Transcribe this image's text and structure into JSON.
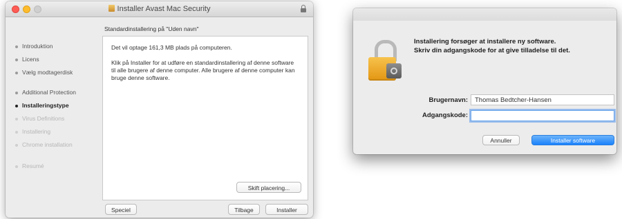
{
  "installer": {
    "title": "Installer Avast Mac Security",
    "pane_heading": "Standardinstallering på \"Uden navn\"",
    "steps": [
      {
        "label": "Introduktion",
        "state": "done"
      },
      {
        "label": "Licens",
        "state": "done"
      },
      {
        "label": "Vælg modtagerdisk",
        "state": "done"
      },
      {
        "label": "Additional Protection",
        "state": "done"
      },
      {
        "label": "Installeringstype",
        "state": "active"
      },
      {
        "label": "Virus Definitions",
        "state": "future"
      },
      {
        "label": "Installering",
        "state": "future"
      },
      {
        "label": "Chrome installation",
        "state": "future"
      },
      {
        "label": "Resumé",
        "state": "future"
      }
    ],
    "content_line1": "Det vil optage 161,3 MB plads på computeren.",
    "content_line2": "Klik på Installer for at udføre en standardinstallering af denne software til alle brugere af denne computer. Alle brugere af denne computer kan bruge denne software.",
    "change_location_button": "Skift placering...",
    "special_button": "Speciel",
    "back_button": "Tilbage",
    "install_button": "Installer"
  },
  "auth_dialog": {
    "message_line1": "Installering forsøger at installere ny software.",
    "message_line2": "Skriv din adgangskode for at give tilladelse til det.",
    "username_label": "Brugernavn:",
    "username_value": "Thomas Bedtcher-Hansen",
    "password_label": "Adgangskode:",
    "password_value": "",
    "cancel_button": "Annuller",
    "install_button": "Installer software"
  },
  "colors": {
    "primary_button": "#1a82fb",
    "lock_body": "#f0a92e",
    "focus_ring": "#5896eb"
  }
}
